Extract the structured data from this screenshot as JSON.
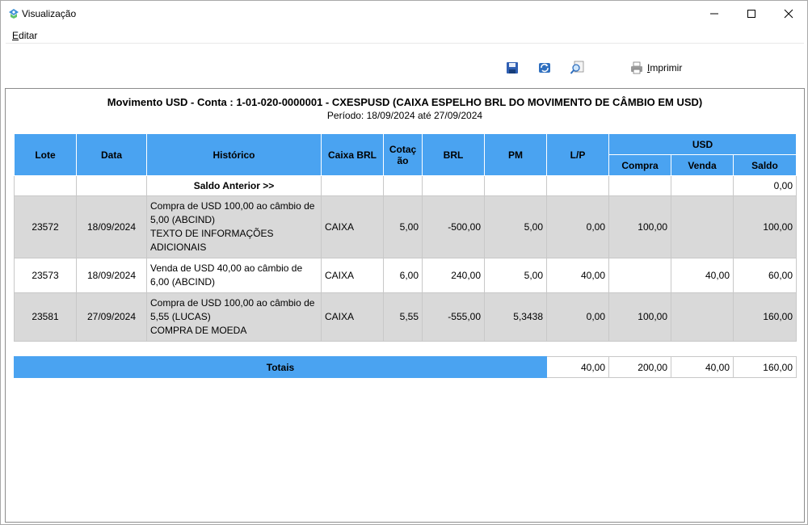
{
  "window": {
    "title": "Visualização"
  },
  "menu": {
    "edit_prefix": "E",
    "edit_rest": "ditar"
  },
  "toolbar": {
    "print_prefix": "I",
    "print_rest": "mprimir"
  },
  "report": {
    "title": "Movimento USD - Conta : 1-01-020-0000001 - CXESPUSD (CAIXA ESPELHO BRL DO MOVIMENTO DE CÂMBIO EM USD)",
    "period": "Período: 18/09/2024 até 27/09/2024"
  },
  "table": {
    "headers": {
      "lote": "Lote",
      "data": "Data",
      "historico": "Histórico",
      "caixa": "Caixa BRL",
      "cotacao_1": "Cotaç",
      "cotacao_2": "ão",
      "brl": "BRL",
      "pm": "PM",
      "lp": "L/P",
      "usd": "USD",
      "compra": "Compra",
      "venda": "Venda",
      "saldo": "Saldo"
    },
    "saldo_anterior": {
      "label": "Saldo Anterior >>",
      "saldo": "0,00"
    },
    "rows": [
      {
        "lote": "23572",
        "data": "18/09/2024",
        "historico": [
          "Compra de USD 100,00 ao câmbio de 5,00 (ABCIND)",
          "TEXTO DE INFORMAÇÕES ADICIONAIS"
        ],
        "caixa": "CAIXA",
        "cotacao": "5,00",
        "brl": "-500,00",
        "pm": "5,00",
        "lp": "0,00",
        "compra": "100,00",
        "venda": "",
        "saldo": "100,00"
      },
      {
        "lote": "23573",
        "data": "18/09/2024",
        "historico": [
          "Venda de USD 40,00 ao câmbio de 6,00 (ABCIND)",
          ""
        ],
        "caixa": "CAIXA",
        "cotacao": "6,00",
        "brl": "240,00",
        "pm": "5,00",
        "lp": "40,00",
        "compra": "",
        "venda": "40,00",
        "saldo": "60,00"
      },
      {
        "lote": "23581",
        "data": "27/09/2024",
        "historico": [
          "Compra de USD 100,00 ao câmbio de 5,55 (LUCAS)",
          "COMPRA DE MOEDA"
        ],
        "caixa": "CAIXA",
        "cotacao": "5,55",
        "brl": "-555,00",
        "pm": "5,3438",
        "lp": "0,00",
        "compra": "100,00",
        "venda": "",
        "saldo": "160,00"
      }
    ],
    "totals": {
      "label": "Totais",
      "lp": "40,00",
      "compra": "200,00",
      "venda": "40,00",
      "saldo": "160,00"
    }
  },
  "colors": {
    "header_blue": "#4aa3f1",
    "row_gray": "#d9d9d9"
  },
  "icons": [
    "app-icon",
    "minimize-icon",
    "maximize-icon",
    "close-icon",
    "save-icon",
    "refresh-icon",
    "zoom-icon",
    "printer-icon"
  ]
}
